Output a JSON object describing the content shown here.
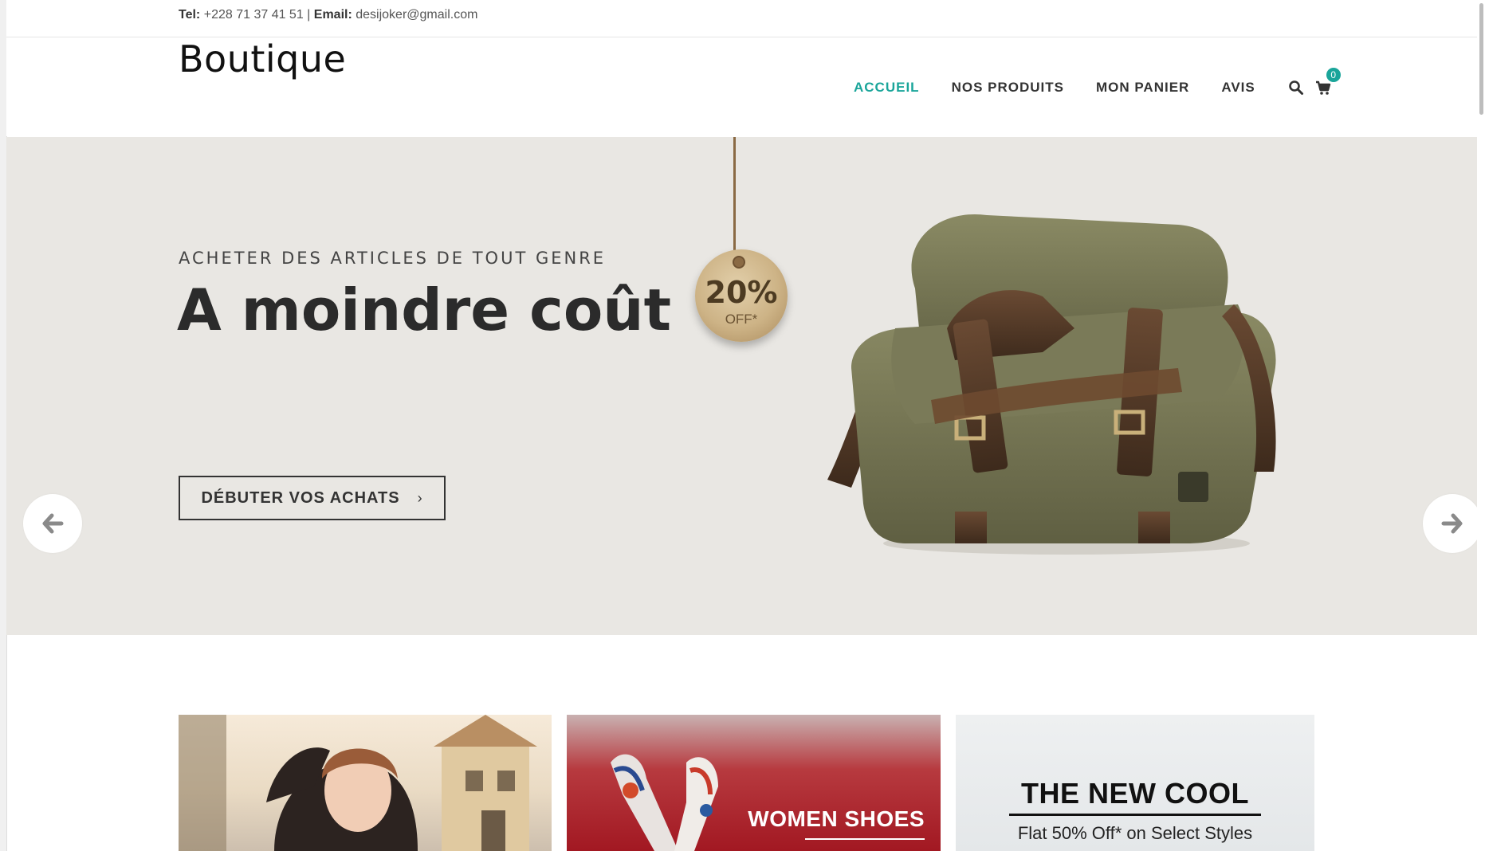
{
  "topbar": {
    "tel_label": "Tel:",
    "tel_value": "+228 71 37 41 51 |",
    "email_label": "Email:",
    "email_value": "desijoker@gmail.com"
  },
  "header": {
    "brand": "Boutique",
    "nav": [
      {
        "label": "ACCUEIL",
        "active": true
      },
      {
        "label": "NOS PRODUITS",
        "active": false
      },
      {
        "label": "MON PANIER",
        "active": false
      },
      {
        "label": "AVIS",
        "active": false
      }
    ],
    "search_icon": "search-icon",
    "cart_icon": "cart-icon",
    "cart_count": "0",
    "accent_color": "#1aa59a"
  },
  "hero": {
    "kicker": "ACHETER DES ARTICLES DE TOUT GENRE",
    "headline": "A moindre coût",
    "cta_label": "DÉBUTER VOS ACHATS",
    "cta_icon": "chevron-right-icon",
    "tag_percent": "20%",
    "tag_off": "OFF*",
    "prev_icon": "arrow-left-icon",
    "next_icon": "arrow-right-icon",
    "background": "#e9e7e3"
  },
  "banners": [
    {
      "title": "",
      "subtitle": ""
    },
    {
      "title": "WOMEN SHOES",
      "subtitle": ""
    },
    {
      "title": "THE NEW COOL",
      "subtitle": "Flat 50% Off* on Select Styles"
    }
  ]
}
